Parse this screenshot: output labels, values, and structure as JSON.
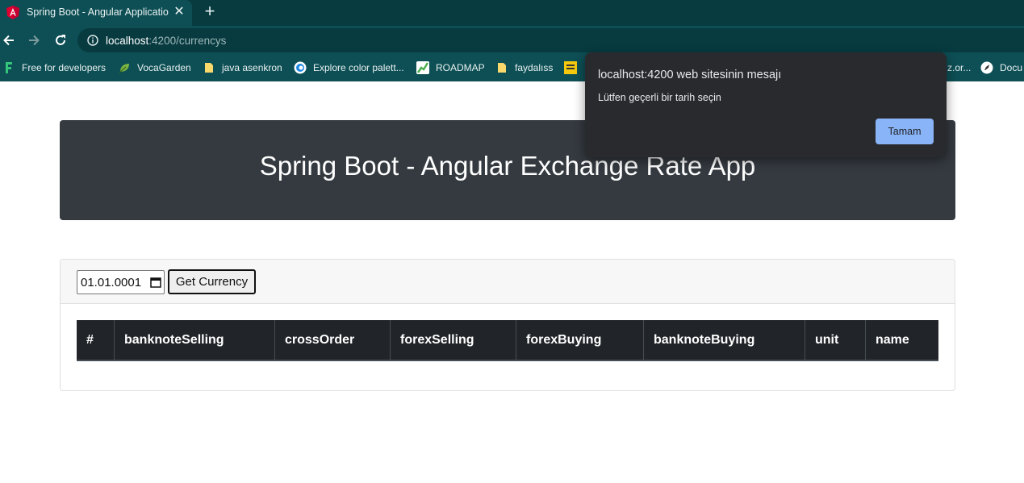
{
  "browser": {
    "tab": {
      "title": "Spring Boot - Angular Application",
      "close_label": "✕"
    },
    "new_tab_label": "+",
    "address": {
      "host": "localhost",
      "rest": ":4200/currencys"
    },
    "bookmarks": [
      {
        "label": "Free for developers"
      },
      {
        "label": "VocaGarden"
      },
      {
        "label": "java asenkron"
      },
      {
        "label": "Explore color palett..."
      },
      {
        "label": "ROADMAP"
      },
      {
        "label": "faydalıss"
      },
      {
        "label": "z.or..."
      },
      {
        "label": "Docu"
      }
    ]
  },
  "page": {
    "title": "Spring Boot - Angular Exchange Rate App",
    "date_value": "01.01.0001",
    "get_button": "Get Currency",
    "table_headers": [
      "#",
      "banknoteSelling",
      "crossOrder",
      "forexSelling",
      "forexBuying",
      "banknoteBuying",
      "unit",
      "name"
    ]
  },
  "dialog": {
    "title": "localhost:4200 web sitesinin mesajı",
    "message": "Lütfen geçerli bir tarih seçin",
    "ok_label": "Tamam"
  },
  "colors": {
    "tab_strip": "#073b40",
    "toolbar": "#0d4f55",
    "jumbotron": "#343a40",
    "table_header": "#212529",
    "dialog_bg": "#292a2d",
    "dialog_button": "#8ab4f8"
  }
}
